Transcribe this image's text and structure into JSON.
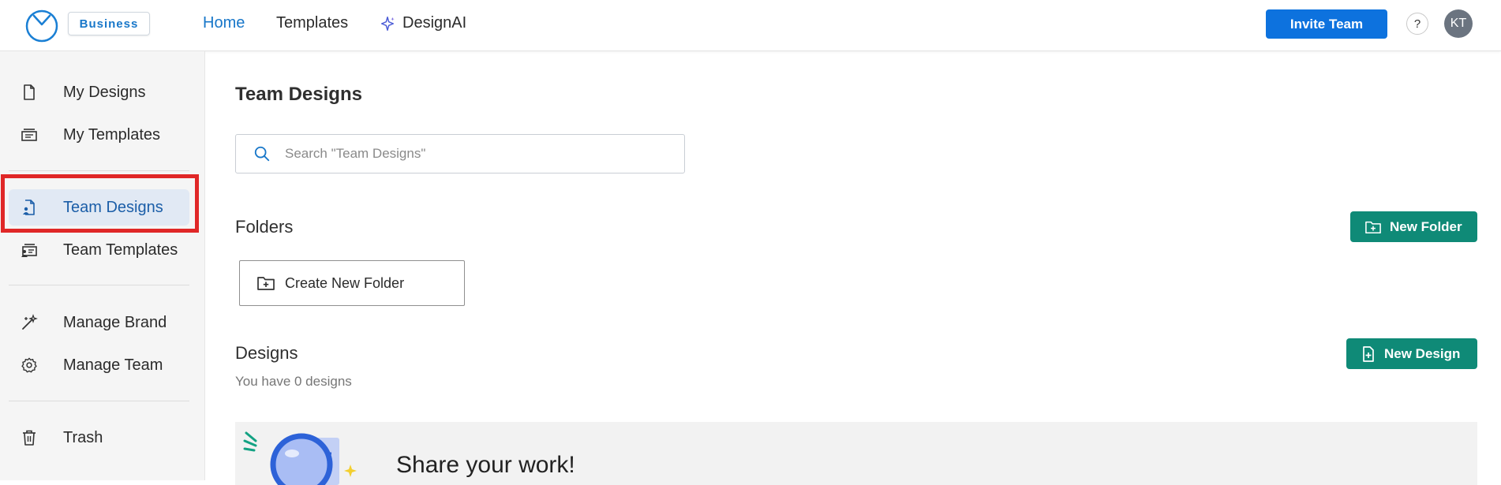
{
  "header": {
    "badge": "Business",
    "nav": {
      "home": "Home",
      "templates": "Templates",
      "designai": "DesignAI"
    },
    "invite_label": "Invite Team",
    "help_label": "?",
    "avatar_initials": "KT"
  },
  "sidebar": {
    "items": [
      {
        "label": "My Designs",
        "icon": "file-icon"
      },
      {
        "label": "My Templates",
        "icon": "template-icon"
      },
      {
        "label": "Team Designs",
        "icon": "team-file-icon",
        "selected": true
      },
      {
        "label": "Team Templates",
        "icon": "team-template-icon"
      },
      {
        "label": "Manage Brand",
        "icon": "magic-wand-icon"
      },
      {
        "label": "Manage Team",
        "icon": "gear-icon"
      },
      {
        "label": "Trash",
        "icon": "trash-icon"
      }
    ]
  },
  "main": {
    "title": "Team Designs",
    "search_placeholder": "Search \"Team Designs\"",
    "folders": {
      "title": "Folders",
      "new_button": "New Folder",
      "create_label": "Create New Folder"
    },
    "designs": {
      "title": "Designs",
      "new_button": "New Design",
      "count_text": "You have 0 designs"
    },
    "share_banner": {
      "text": "Share your work!"
    }
  },
  "colors": {
    "primary_blue": "#0d72de",
    "link_blue": "#1877c9",
    "green": "#0f8a77",
    "highlight_red": "#e02727",
    "selected_bg": "#e1e9f4"
  }
}
